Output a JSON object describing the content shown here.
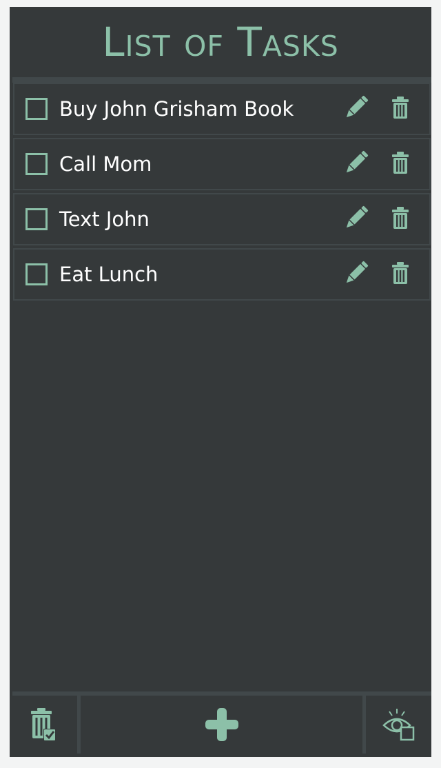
{
  "header": {
    "title": "List of Tasks"
  },
  "tasks": [
    {
      "label": "Buy John Grisham Book",
      "checked": false
    },
    {
      "label": "Call Mom",
      "checked": false
    },
    {
      "label": "Text John",
      "checked": false
    },
    {
      "label": "Eat Lunch",
      "checked": false
    }
  ],
  "footer": {
    "left_icon": "clear-completed-icon",
    "center_icon": "plus-icon",
    "right_icon": "toggle-visibility-icon"
  },
  "colors": {
    "background": "#35393a",
    "accent": "#8cc0a8",
    "divider": "#41484a",
    "text": "#ffffff"
  }
}
